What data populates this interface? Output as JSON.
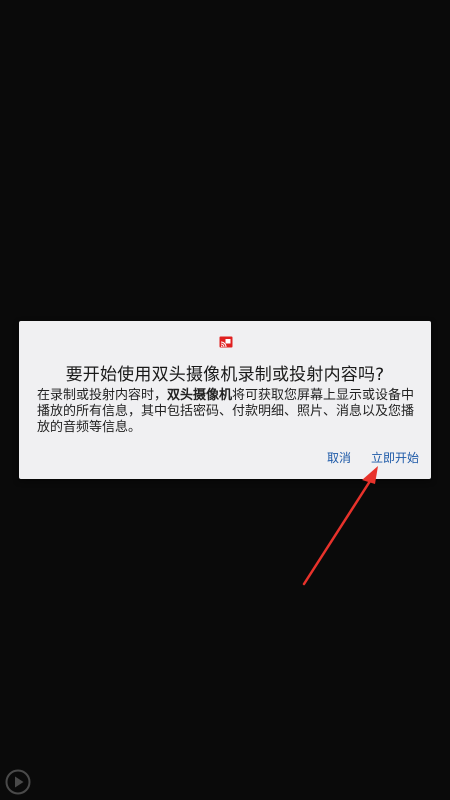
{
  "dialog": {
    "title": "要开始使用双头摄像机录制或投射内容吗?",
    "body_prefix": "在录制或投射内容时，",
    "app_name": "双头摄像机",
    "body_suffix": "将可获取您屏幕上显示或设备中播放的所有信息，其中包括密码、付款明细、照片、消息以及您播放的音频等信息。",
    "cancel_label": "取消",
    "start_label": "立即开始"
  },
  "colors": {
    "background": "#0a0a0a",
    "dialog_bg": "#f0f0f2",
    "button_text": "#1e5aa8",
    "cast_icon": "#e02020",
    "arrow": "#e8322b"
  },
  "icons": {
    "cast": "cast-icon",
    "play": "play-circle-icon"
  }
}
